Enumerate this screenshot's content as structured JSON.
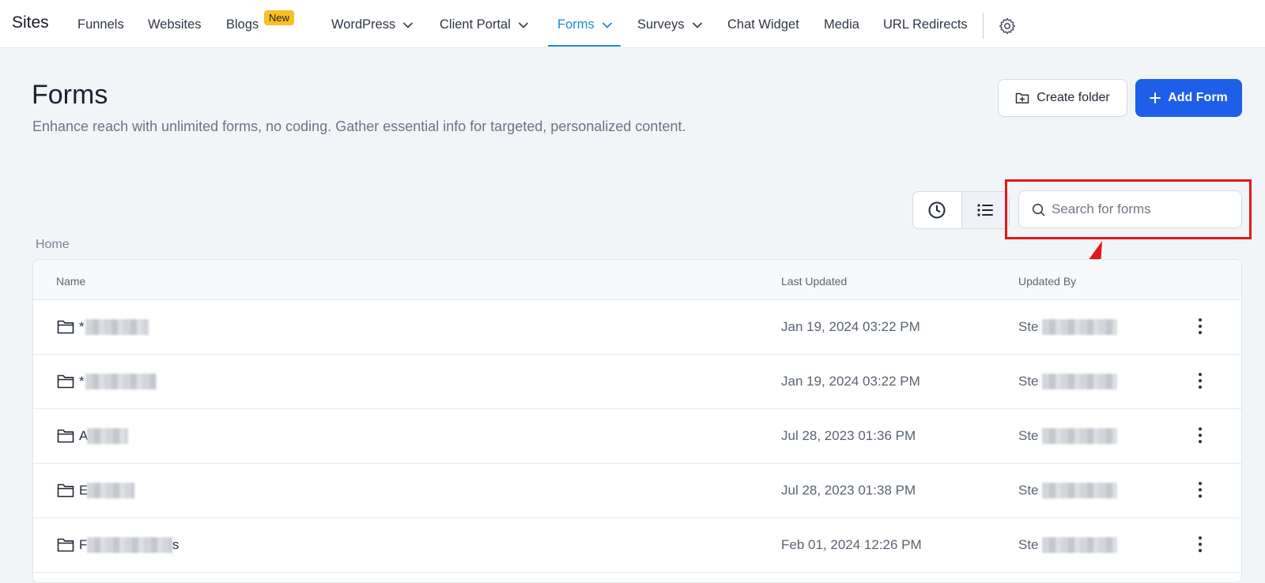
{
  "nav": {
    "brand": "Sites",
    "items": [
      {
        "label": "Funnels"
      },
      {
        "label": "Websites"
      },
      {
        "label": "Blogs",
        "badge": "New"
      },
      {
        "label": "WordPress"
      },
      {
        "label": "Client Portal"
      },
      {
        "label": "Forms"
      },
      {
        "label": "Surveys"
      },
      {
        "label": "Chat Widget"
      },
      {
        "label": "Media"
      },
      {
        "label": "URL Redirects"
      }
    ],
    "active": "Forms",
    "settings_icon": "gear-icon"
  },
  "header": {
    "title": "Forms",
    "description": "Enhance reach with unlimited forms, no coding. Gather essential info for targeted, personalized content.",
    "create_folder_label": "Create folder",
    "add_form_label": "Add Form"
  },
  "search": {
    "placeholder": "Search for forms",
    "value": ""
  },
  "breadcrumb": "Home",
  "table": {
    "columns": [
      "Name",
      "Last Updated",
      "Updated By"
    ],
    "rows": [
      {
        "name": "*",
        "updated": "Jan 19, 2024 03:22 PM",
        "by": "Ste"
      },
      {
        "name": "*",
        "updated": "Jan 19, 2024 03:22 PM",
        "by": "Ste"
      },
      {
        "name": "A",
        "updated": "Jul 28, 2023 01:36 PM",
        "by": "Ste"
      },
      {
        "name": "E",
        "updated": "Jul 28, 2023 01:38 PM",
        "by": "Ste"
      },
      {
        "name": "F",
        "name_suffix": "s",
        "updated": "Feb 01, 2024 12:26 PM",
        "by": "Ste"
      }
    ]
  },
  "colors": {
    "accent": "#1e88d6",
    "primary_button": "#1d5fe8",
    "badge": "#fbbf24",
    "annotation": "#e4171b"
  }
}
